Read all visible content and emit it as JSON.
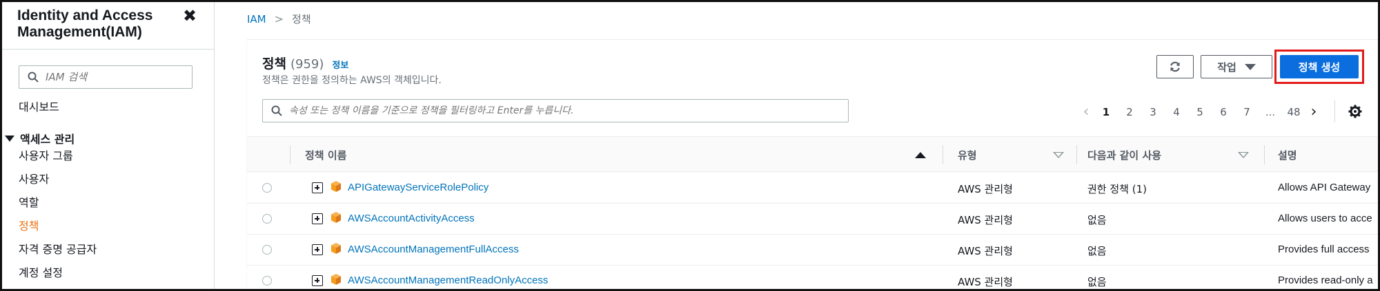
{
  "sidebar": {
    "title": "Identity and Access Management(IAM)",
    "search_placeholder": "IAM 검색",
    "dashboard": "대시보드",
    "group_label": "액세스 관리",
    "items": [
      {
        "label": "사용자 그룹"
      },
      {
        "label": "사용자"
      },
      {
        "label": "역할"
      },
      {
        "label": "정책"
      },
      {
        "label": "자격 증명 공급자"
      },
      {
        "label": "계정 설정"
      }
    ]
  },
  "breadcrumb": {
    "root": "IAM",
    "current": "정책"
  },
  "panel": {
    "title": "정책",
    "count": "(959)",
    "info": "정보",
    "description": "정책은 권한을 정의하는 AWS의 객체입니다.",
    "actions_label": "작업",
    "create_label": "정책 생성",
    "filter_placeholder": "속성 또는 정책 이름을 기준으로 정책을 필터링하고 Enter를 누릅니다."
  },
  "pagination": {
    "pages": [
      "1",
      "2",
      "3",
      "4",
      "5",
      "6",
      "7"
    ],
    "ellipsis": "...",
    "last": "48"
  },
  "table": {
    "columns": {
      "name": "정책 이름",
      "type": "유형",
      "used_as": "다음과 같이 사용",
      "description": "설명"
    },
    "rows": [
      {
        "name": "APIGatewayServiceRolePolicy",
        "type": "AWS 관리형",
        "used_as": "권한 정책 (1)",
        "description": "Allows API Gateway"
      },
      {
        "name": "AWSAccountActivityAccess",
        "type": "AWS 관리형",
        "used_as": "없음",
        "description": "Allows users to acce"
      },
      {
        "name": "AWSAccountManagementFullAccess",
        "type": "AWS 관리형",
        "used_as": "없음",
        "description": "Provides full access"
      },
      {
        "name": "AWSAccountManagementReadOnlyAccess",
        "type": "AWS 관리형",
        "used_as": "없음",
        "description": "Provides read-only a"
      }
    ]
  },
  "colors": {
    "link": "#0073bb",
    "active_nav": "#ec7211",
    "primary_button": "#0a6ede",
    "highlight_border": "#e21a1a",
    "aws_cube": "#f89c1c"
  }
}
